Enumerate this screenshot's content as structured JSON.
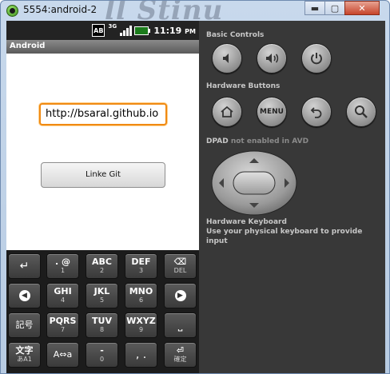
{
  "window": {
    "title": "5554:android-2",
    "watermark": "ll Stinu",
    "controls": {
      "minimize": "▬",
      "maximize": "▢",
      "close": "✕"
    }
  },
  "status_bar": {
    "ab_label": "AB",
    "net_label": "3G",
    "time": "11:19",
    "ampm": "PM"
  },
  "app": {
    "title": "Android",
    "url_value": "http://bsaral.github.io",
    "button_label": "Linke Git"
  },
  "keyboard": {
    "keys": [
      {
        "main": "↵",
        "sub": ""
      },
      {
        "main": ". @",
        "sub": "1"
      },
      {
        "main": "ABC",
        "sub": "2"
      },
      {
        "main": "DEF",
        "sub": "3"
      },
      {
        "main": "⌫",
        "sub": "DEL"
      },
      {
        "main": "◀",
        "sub": ""
      },
      {
        "main": "GHI",
        "sub": "4"
      },
      {
        "main": "JKL",
        "sub": "5"
      },
      {
        "main": "MNO",
        "sub": "6"
      },
      {
        "main": "▶",
        "sub": ""
      },
      {
        "main": "記号",
        "sub": ""
      },
      {
        "main": "PQRS",
        "sub": "7"
      },
      {
        "main": "TUV",
        "sub": "8"
      },
      {
        "main": "WXYZ",
        "sub": "9"
      },
      {
        "main": "⎵",
        "sub": ""
      },
      {
        "main": "文字",
        "sub": "あA1"
      },
      {
        "main": "A⇔a",
        "sub": ""
      },
      {
        "main": "-",
        "sub": "0"
      },
      {
        "main": ", .",
        "sub": ""
      },
      {
        "main": "⏎",
        "sub": "確定"
      }
    ]
  },
  "panel": {
    "basic_controls_label": "Basic Controls",
    "hardware_buttons_label": "Hardware Buttons",
    "menu_label": "MENU",
    "dpad_label": "DPAD",
    "dpad_status": "not enabled in AVD",
    "hw_keyboard_title": "Hardware Keyboard",
    "hw_keyboard_hint": "Use your physical keyboard to provide input"
  },
  "colors": {
    "focus_border": "#f08a13",
    "panel_bg": "#383838",
    "keyboard_bg": "#1c1c1c"
  }
}
